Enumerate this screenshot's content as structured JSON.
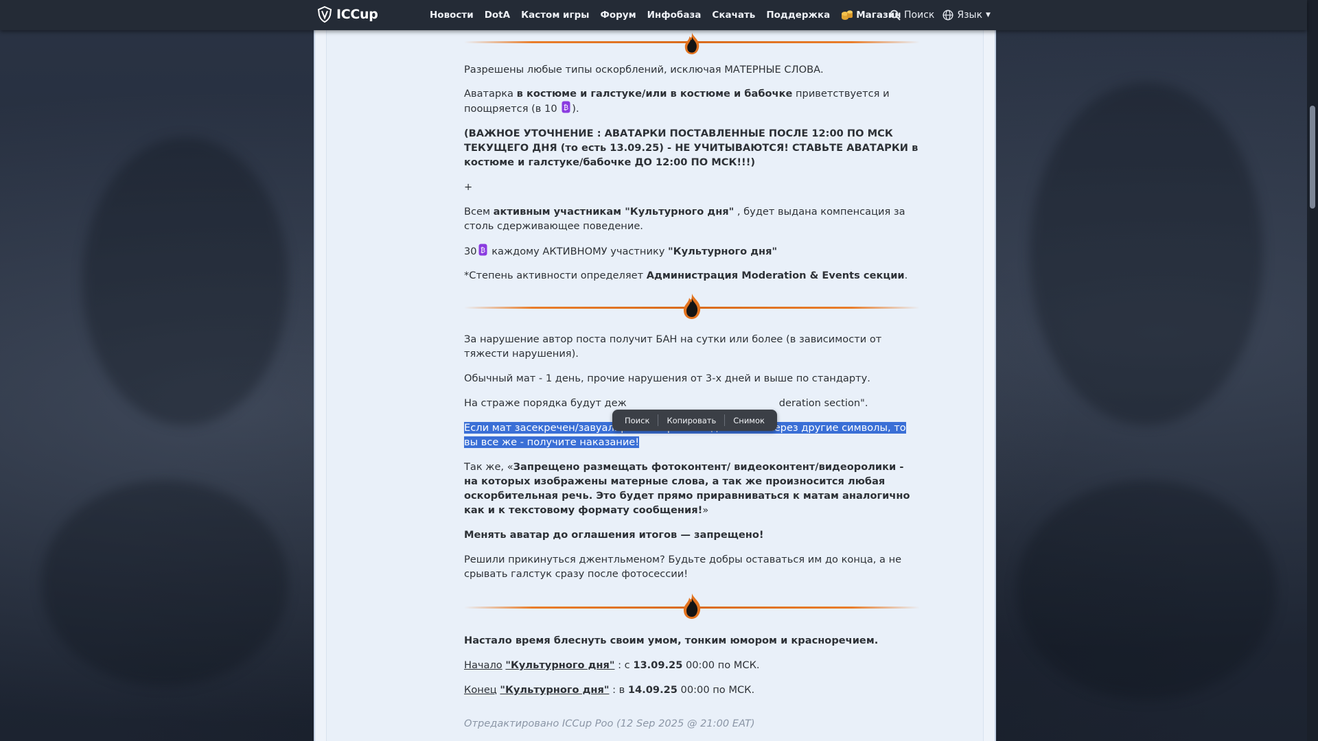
{
  "nav": {
    "logo_text": "ICCup",
    "items": [
      "Новости",
      "DotA",
      "Кастом игры",
      "Форум",
      "Инфобаза",
      "Скачать",
      "Поддержка"
    ],
    "shop_label": "Магазин",
    "search_label": "Поиск",
    "language_label": "Язык"
  },
  "content": {
    "p1": "Разрешены любые типы оскорблений, исключая МАТЕРНЫЕ СЛОВА.",
    "p2": {
      "a": "Аватарка ",
      "b": "в костюме и галстуке/или в костюме и бабочке",
      "c": " приветствуется и поощряется (в 10",
      "d": ")."
    },
    "p3": "(ВАЖНОЕ УТОЧНЕНИЕ : АВАТАРКИ ПОСТАВЛЕННЫЕ ПОСЛЕ 12:00 ПО МСК ТЕКУЩЕГО ДНЯ (то есть 13.09.25) - НЕ УЧИТЫВАЮТСЯ! СТАВЬТЕ АВАТАРКИ в костюме и галстуке/бабочке ДО 12:00 ПО МСК!!!)",
    "plus": "+",
    "p4": {
      "a": "Всем ",
      "b": "активным участникам \"Культурного дня\"",
      "c": " , будет выдана компенсация за столь сдерживающее поведение."
    },
    "p5": {
      "a": "30",
      "b": " каждому АКТИВНОМУ участнику ",
      "c": "\"Культурного дня\""
    },
    "p6": {
      "a": "*Степень активности определяет ",
      "b": "Администрация Moderation & Events секции",
      "c": "."
    },
    "p7": "За нарушение автор поста получит БАН на сутки или более (в зависимости от тяжести нарушения).",
    "p8": "Обычный мат - 1 день, прочие нарушения от 3-х дней и выше по стандарту.",
    "p9": {
      "a": "На страже порядка будут деж",
      "b": "deration section\"."
    },
    "p10": "Если мат засекречен/завуалирован через звёздочки или через другие символы, то вы все же - получите наказание!",
    "p11": {
      "a": "Так же, «",
      "b": "Запрещено размещать фотоконтент/ видеоконтент/видеоролики - на которых изображены матерные слова, а так же произносится любая оскорбительная речь. Это будет прямо приравниваться к матам аналогично как и к текстовому формату сообщения!",
      "c": "»"
    },
    "p12": "Менять аватар до оглашения итогов — запрещено!",
    "p13": "Решили прикинуться джентльменом? Будьте добры оставаться им до конца, а не срывать галстук сразу после фотосессии!",
    "p14": "Настало время блеснуть своим умом, тонким юмором и красноречием.",
    "p15": {
      "a": "Начало",
      "b": "\"Культурного дня\"",
      "c": " : с ",
      "d": "13.09.25",
      "e": " 00:00 по МСК."
    },
    "p16": {
      "a": "Конец",
      "b": "\"Культурного дня\"",
      "c": " : в ",
      "d": "14.09.25",
      "e": " 00:00 по МСК."
    },
    "edited": "Отредактировано ICCup Poo (12 Sep 2025 @ 21:00 EAT)"
  },
  "popup": {
    "search": "Поиск",
    "copy": "Копировать",
    "snapshot": "Снимок"
  },
  "colors": {
    "accent_orange": "#e97d2a",
    "selection": "#3a6fd6",
    "topbar": "#242b36",
    "panel": "#e9f0f9"
  }
}
